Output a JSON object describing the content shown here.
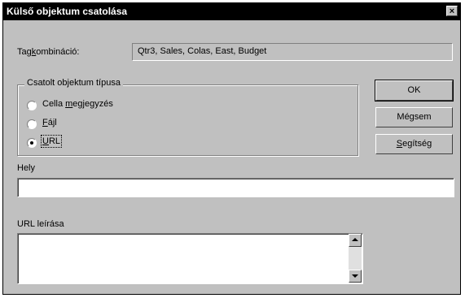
{
  "window": {
    "title": "Külső objektum csatolása",
    "close_glyph": "×"
  },
  "member_combination": {
    "label_prefix": "Tag",
    "label_accel": "k",
    "label_suffix": "ombináció:",
    "value": "Qtr3, Sales, Colas, East, Budget"
  },
  "object_type_group": {
    "legend": "Csatolt objektum típusa",
    "options": [
      {
        "label_prefix": "Cella ",
        "label_accel": "m",
        "label_suffix": "egjegyzés",
        "selected": false
      },
      {
        "label_prefix": "",
        "label_accel": "F",
        "label_suffix": "ájl",
        "selected": false
      },
      {
        "label_prefix": "",
        "label_accel": "U",
        "label_suffix": "RL",
        "selected": true
      }
    ]
  },
  "buttons": {
    "ok": "OK",
    "cancel": "Mégsem",
    "help_accel": "S",
    "help_suffix": "egítség"
  },
  "location": {
    "label": "Hely",
    "value": ""
  },
  "url_description": {
    "label": "URL leírása",
    "value": ""
  }
}
